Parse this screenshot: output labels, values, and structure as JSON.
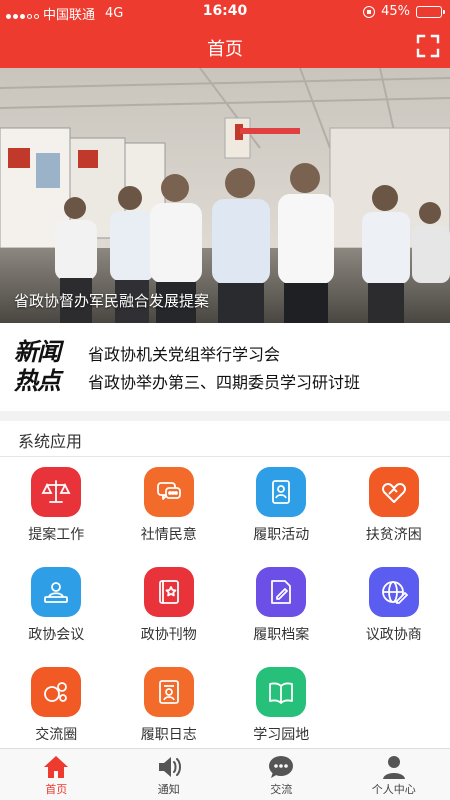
{
  "status_bar": {
    "carrier": "中国联通",
    "network": "4G",
    "time": "16:40",
    "battery": "45%",
    "battery_level": 0.45
  },
  "nav": {
    "title": "首页",
    "scan_icon": "scan-icon"
  },
  "banner": {
    "caption": "省政协督办军民融合发展提案"
  },
  "news": {
    "logo_line1": "新闻",
    "logo_line2": "热点",
    "items": [
      "省政协机关党组举行学习会",
      "省政协举办第三、四期委员学习研讨班"
    ]
  },
  "apps": {
    "section_title": "系统应用",
    "items": [
      {
        "label": "提案工作",
        "icon": "scales-icon",
        "color": "#e8333a"
      },
      {
        "label": "社情民意",
        "icon": "chat-bubble-icon",
        "color": "#f26b2b"
      },
      {
        "label": "履职活动",
        "icon": "document-person-icon",
        "color": "#2e9fe6"
      },
      {
        "label": "扶贫济困",
        "icon": "heart-hand-icon",
        "color": "#f25a25"
      },
      {
        "label": "政协会议",
        "icon": "meeting-icon",
        "color": "#2e9fe6"
      },
      {
        "label": "政协刊物",
        "icon": "journal-star-icon",
        "color": "#e8333a"
      },
      {
        "label": "履职档案",
        "icon": "archive-edit-icon",
        "color": "#6b4fe6"
      },
      {
        "label": "议政协商",
        "icon": "globe-pen-icon",
        "color": "#5b5cf0"
      },
      {
        "label": "交流圈",
        "icon": "circles-icon",
        "color": "#f25a25"
      },
      {
        "label": "履职日志",
        "icon": "log-person-icon",
        "color": "#f26b2b"
      },
      {
        "label": "学习园地",
        "icon": "open-book-icon",
        "color": "#27c07a"
      }
    ]
  },
  "tabs": [
    {
      "label": "首页",
      "icon": "home-icon",
      "active": true
    },
    {
      "label": "通知",
      "icon": "speaker-icon",
      "active": false
    },
    {
      "label": "交流",
      "icon": "chat-icon",
      "active": false
    },
    {
      "label": "个人中心",
      "icon": "person-icon",
      "active": false
    }
  ],
  "colors": {
    "brand_red": "#ee3b2f",
    "tab_inactive": "#555555"
  }
}
